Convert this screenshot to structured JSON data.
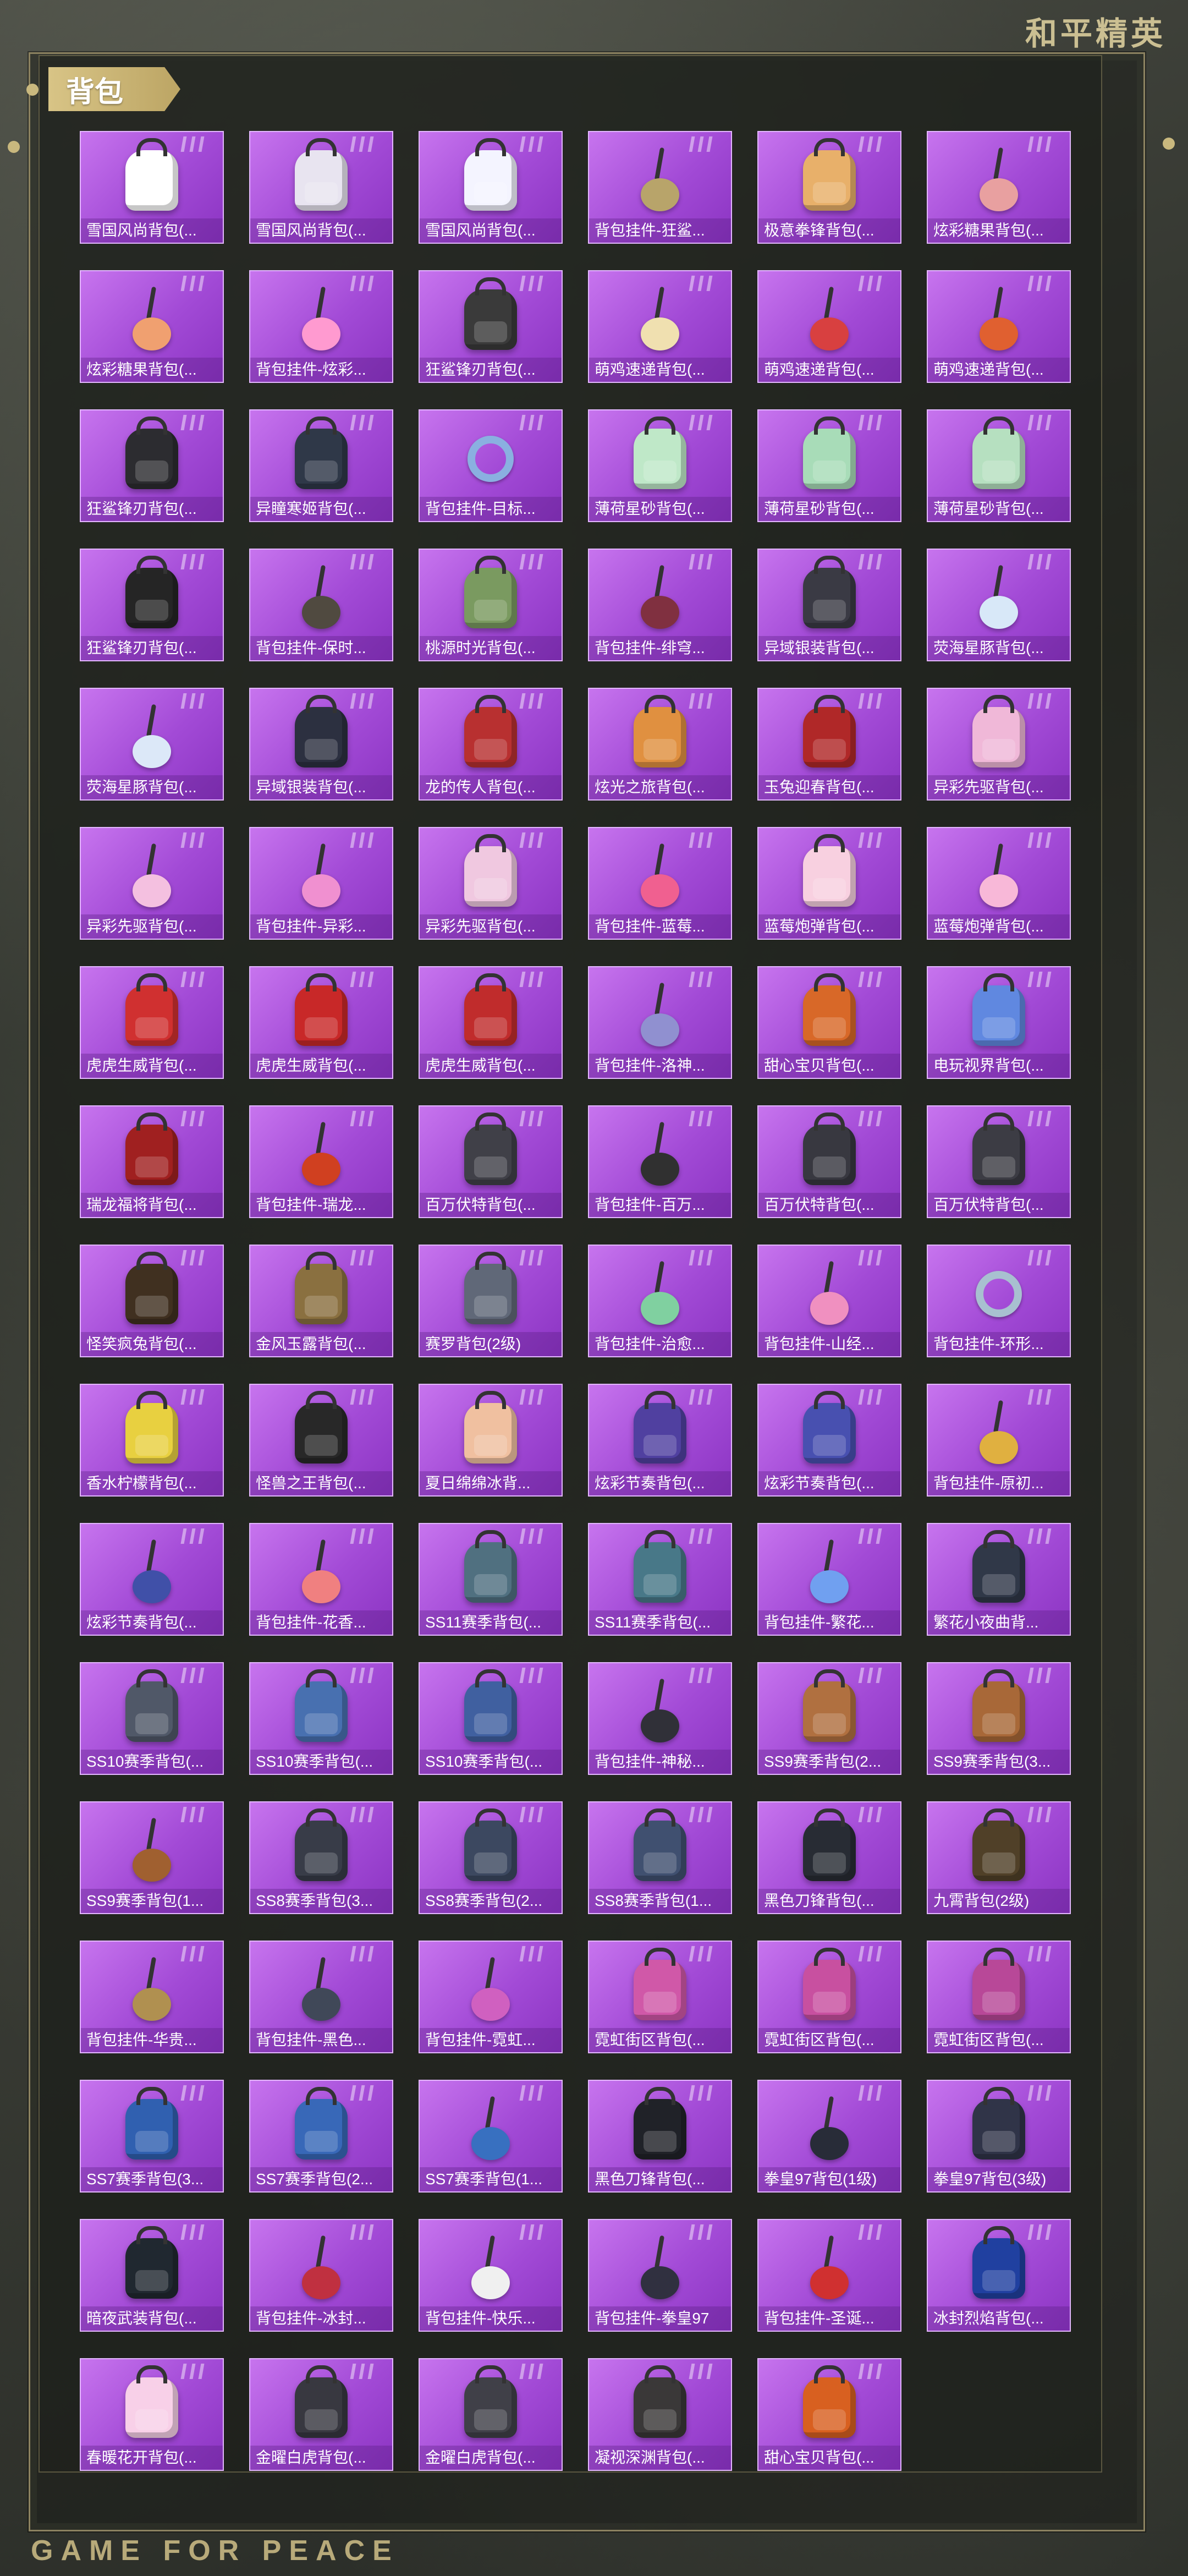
{
  "brand_top": "和平精英",
  "brand_bottom": "GAME FOR PEACE",
  "section_title": "背包",
  "colors": {
    "card_top": "#c774ee",
    "card_bottom": "#8b34c2",
    "frame": "#8c8260",
    "header_tag": "#d8c486"
  },
  "items": [
    {
      "label": "雪国风尚背包(...",
      "kind": "backpack",
      "color": "#ffffff"
    },
    {
      "label": "雪国风尚背包(...",
      "kind": "backpack",
      "color": "#e8e4f0"
    },
    {
      "label": "雪国风尚背包(...",
      "kind": "backpack",
      "color": "#f4f4ff"
    },
    {
      "label": "背包挂件-狂鲨...",
      "kind": "pendant",
      "color": "#b8a46a"
    },
    {
      "label": "极意拳锋背包(...",
      "kind": "backpack",
      "color": "#e8b06a"
    },
    {
      "label": "炫彩糖果背包(...",
      "kind": "pendant",
      "color": "#e8a0a0"
    },
    {
      "label": "炫彩糖果背包(...",
      "kind": "pendant",
      "color": "#f0a070"
    },
    {
      "label": "背包挂件-炫彩...",
      "kind": "pendant",
      "color": "#ff9ad0"
    },
    {
      "label": "狂鲨锋刃背包(...",
      "kind": "backpack",
      "color": "#3a3a3a"
    },
    {
      "label": "萌鸡速递背包(...",
      "kind": "pendant",
      "color": "#f0e0b0"
    },
    {
      "label": "萌鸡速递背包(...",
      "kind": "pendant",
      "color": "#d84040"
    },
    {
      "label": "萌鸡速递背包(...",
      "kind": "pendant",
      "color": "#e06030"
    },
    {
      "label": "狂鲨锋刃背包(...",
      "kind": "backpack",
      "color": "#2c2c30"
    },
    {
      "label": "异瞳寒姬背包(...",
      "kind": "backpack",
      "color": "#2f3848"
    },
    {
      "label": "背包挂件-目标...",
      "kind": "ring",
      "color": "#8ab0e0"
    },
    {
      "label": "薄荷星砂背包(...",
      "kind": "backpack",
      "color": "#bfe8c8"
    },
    {
      "label": "薄荷星砂背包(...",
      "kind": "backpack",
      "color": "#a8dcb8"
    },
    {
      "label": "薄荷星砂背包(...",
      "kind": "backpack",
      "color": "#b6e0c0"
    },
    {
      "label": "狂鲨锋刃背包(...",
      "kind": "backpack",
      "color": "#252525"
    },
    {
      "label": "背包挂件-保时...",
      "kind": "pendant",
      "color": "#504a40"
    },
    {
      "label": "桃源时光背包(...",
      "kind": "backpack",
      "color": "#7a9a60"
    },
    {
      "label": "背包挂件-绯穹...",
      "kind": "pendant",
      "color": "#803040"
    },
    {
      "label": "异域银装背包(...",
      "kind": "backpack",
      "color": "#3a3a44"
    },
    {
      "label": "荧海星豚背包(...",
      "kind": "pendant",
      "color": "#d8e8f8"
    },
    {
      "label": "荧海星豚背包(...",
      "kind": "pendant",
      "color": "#dce8f8"
    },
    {
      "label": "异域银装背包(...",
      "kind": "backpack",
      "color": "#2c3040"
    },
    {
      "label": "龙的传人背包(...",
      "kind": "backpack",
      "color": "#b83030"
    },
    {
      "label": "炫光之旅背包(...",
      "kind": "backpack",
      "color": "#e09040"
    },
    {
      "label": "玉兔迎春背包(...",
      "kind": "backpack",
      "color": "#b02828"
    },
    {
      "label": "异彩先驱背包(...",
      "kind": "backpack",
      "color": "#f0b8d8"
    },
    {
      "label": "异彩先驱背包(...",
      "kind": "pendant",
      "color": "#f4c0e0"
    },
    {
      "label": "背包挂件-异彩...",
      "kind": "pendant",
      "color": "#f090d0"
    },
    {
      "label": "异彩先驱背包(...",
      "kind": "backpack",
      "color": "#f0c8e0"
    },
    {
      "label": "背包挂件-蓝莓...",
      "kind": "pendant",
      "color": "#f06090"
    },
    {
      "label": "蓝莓炮弹背包(...",
      "kind": "backpack",
      "color": "#f8d0e0"
    },
    {
      "label": "蓝莓炮弹背包(...",
      "kind": "pendant",
      "color": "#f8b8d8"
    },
    {
      "label": "虎虎生威背包(...",
      "kind": "backpack",
      "color": "#d03030"
    },
    {
      "label": "虎虎生威背包(...",
      "kind": "backpack",
      "color": "#c82828"
    },
    {
      "label": "虎虎生威背包(...",
      "kind": "backpack",
      "color": "#c02c2c"
    },
    {
      "label": "背包挂件-洛神...",
      "kind": "pendant",
      "color": "#9090d0"
    },
    {
      "label": "甜心宝贝背包(...",
      "kind": "backpack",
      "color": "#d86828"
    },
    {
      "label": "电玩视界背包(...",
      "kind": "backpack",
      "color": "#6088e0"
    },
    {
      "label": "瑞龙福将背包(...",
      "kind": "backpack",
      "color": "#a02020"
    },
    {
      "label": "背包挂件-瑞龙...",
      "kind": "pendant",
      "color": "#d04020"
    },
    {
      "label": "百万伏特背包(...",
      "kind": "backpack",
      "color": "#404048"
    },
    {
      "label": "背包挂件-百万...",
      "kind": "pendant",
      "color": "#303030"
    },
    {
      "label": "百万伏特背包(...",
      "kind": "backpack",
      "color": "#383840"
    },
    {
      "label": "百万伏特背包(...",
      "kind": "backpack",
      "color": "#3c3c44"
    },
    {
      "label": "怪笑疯兔背包(...",
      "kind": "backpack",
      "color": "#403020"
    },
    {
      "label": "金风玉露背包(...",
      "kind": "backpack",
      "color": "#8a7040"
    },
    {
      "label": "赛罗背包(2级)",
      "kind": "backpack",
      "color": "#606878"
    },
    {
      "label": "背包挂件-治愈...",
      "kind": "pendant",
      "color": "#80d0a0"
    },
    {
      "label": "背包挂件-山经...",
      "kind": "pendant",
      "color": "#f090c0"
    },
    {
      "label": "背包挂件-环形...",
      "kind": "ring",
      "color": "#a8c0d0"
    },
    {
      "label": "香水柠檬背包(...",
      "kind": "backpack",
      "color": "#e8d040"
    },
    {
      "label": "怪兽之王背包(...",
      "kind": "backpack",
      "color": "#282828"
    },
    {
      "label": "夏日绵绵冰背...",
      "kind": "backpack",
      "color": "#f0c0a0"
    },
    {
      "label": "炫彩节奏背包(...",
      "kind": "backpack",
      "color": "#5040a0"
    },
    {
      "label": "炫彩节奏背包(...",
      "kind": "backpack",
      "color": "#4850b0"
    },
    {
      "label": "背包挂件-原初...",
      "kind": "pendant",
      "color": "#e0b040"
    },
    {
      "label": "炫彩节奏背包(...",
      "kind": "pendant",
      "color": "#4050a8"
    },
    {
      "label": "背包挂件-花香...",
      "kind": "pendant",
      "color": "#f08080"
    },
    {
      "label": "SS11赛季背包(...",
      "kind": "backpack",
      "color": "#507080"
    },
    {
      "label": "SS11赛季背包(...",
      "kind": "backpack",
      "color": "#487888"
    },
    {
      "label": "背包挂件-繁花...",
      "kind": "pendant",
      "color": "#70a0f0"
    },
    {
      "label": "繁花小夜曲背...",
      "kind": "backpack",
      "color": "#303848"
    },
    {
      "label": "SS10赛季背包(...",
      "kind": "backpack",
      "color": "#505868"
    },
    {
      "label": "SS10赛季背包(...",
      "kind": "backpack",
      "color": "#4870b0"
    },
    {
      "label": "SS10赛季背包(...",
      "kind": "backpack",
      "color": "#4060a0"
    },
    {
      "label": "背包挂件-神秘...",
      "kind": "pendant",
      "color": "#303038"
    },
    {
      "label": "SS9赛季背包(2...",
      "kind": "backpack",
      "color": "#b07040"
    },
    {
      "label": "SS9赛季背包(3...",
      "kind": "backpack",
      "color": "#a86838"
    },
    {
      "label": "SS9赛季背包(1...",
      "kind": "pendant",
      "color": "#a06030"
    },
    {
      "label": "SS8赛季背包(3...",
      "kind": "backpack",
      "color": "#383c48"
    },
    {
      "label": "SS8赛季背包(2...",
      "kind": "backpack",
      "color": "#3c4860"
    },
    {
      "label": "SS8赛季背包(1...",
      "kind": "backpack",
      "color": "#405070"
    },
    {
      "label": "黑色刀锋背包(...",
      "kind": "backpack",
      "color": "#282c34"
    },
    {
      "label": "九霄背包(2级)",
      "kind": "backpack",
      "color": "#504028"
    },
    {
      "label": "背包挂件-华贵...",
      "kind": "pendant",
      "color": "#b09050"
    },
    {
      "label": "背包挂件-黑色...",
      "kind": "pendant",
      "color": "#404858"
    },
    {
      "label": "背包挂件-霓虹...",
      "kind": "pendant",
      "color": "#d060c0"
    },
    {
      "label": "霓虹街区背包(...",
      "kind": "backpack",
      "color": "#d058a8"
    },
    {
      "label": "霓虹街区背包(...",
      "kind": "backpack",
      "color": "#c850a0"
    },
    {
      "label": "霓虹街区背包(...",
      "kind": "backpack",
      "color": "#b84898"
    },
    {
      "label": "SS7赛季背包(3...",
      "kind": "backpack",
      "color": "#3060b0"
    },
    {
      "label": "SS7赛季背包(2...",
      "kind": "backpack",
      "color": "#3868b8"
    },
    {
      "label": "SS7赛季背包(1...",
      "kind": "pendant",
      "color": "#3870c0"
    },
    {
      "label": "黑色刀锋背包(...",
      "kind": "backpack",
      "color": "#202228"
    },
    {
      "label": "拳皇97背包(1级)",
      "kind": "pendant",
      "color": "#282c38"
    },
    {
      "label": "拳皇97背包(3级)",
      "kind": "backpack",
      "color": "#303448"
    },
    {
      "label": "暗夜武装背包(...",
      "kind": "backpack",
      "color": "#202830"
    },
    {
      "label": "背包挂件-冰封...",
      "kind": "pendant",
      "color": "#c03040"
    },
    {
      "label": "背包挂件-快乐...",
      "kind": "pendant",
      "color": "#f0f0f0"
    },
    {
      "label": "背包挂件-拳皇97",
      "kind": "pendant",
      "color": "#303040"
    },
    {
      "label": "背包挂件-圣诞...",
      "kind": "pendant",
      "color": "#d03030"
    },
    {
      "label": "冰封烈焰背包(...",
      "kind": "backpack",
      "color": "#2040a0"
    },
    {
      "label": "春暖花开背包(...",
      "kind": "backpack",
      "color": "#f8d0e8"
    },
    {
      "label": "金曜白虎背包(...",
      "kind": "backpack",
      "color": "#383840"
    },
    {
      "label": "金曜白虎背包(...",
      "kind": "backpack",
      "color": "#404048"
    },
    {
      "label": "凝视深渊背包(...",
      "kind": "backpack",
      "color": "#3a3838"
    },
    {
      "label": "甜心宝贝背包(...",
      "kind": "backpack",
      "color": "#d86020"
    }
  ]
}
